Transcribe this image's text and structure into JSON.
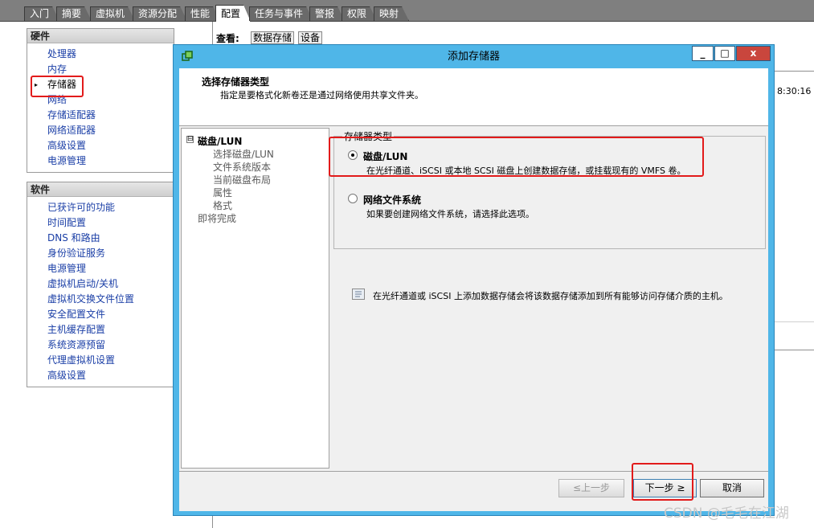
{
  "tabs": [
    {
      "label": "入门",
      "active": false
    },
    {
      "label": "摘要",
      "active": false
    },
    {
      "label": "虚拟机",
      "active": false
    },
    {
      "label": "资源分配",
      "active": false
    },
    {
      "label": "性能",
      "active": false
    },
    {
      "label": "配置",
      "active": true
    },
    {
      "label": "任务与事件",
      "active": false
    },
    {
      "label": "警报",
      "active": false
    },
    {
      "label": "权限",
      "active": false
    },
    {
      "label": "映射",
      "active": false
    }
  ],
  "hardware": {
    "heading": "硬件",
    "items": [
      "处理器",
      "内存",
      "存储器",
      "网络",
      "存储适配器",
      "网络适配器",
      "高级设置",
      "电源管理"
    ],
    "selected": "存储器"
  },
  "software": {
    "heading": "软件",
    "items": [
      "已获许可的功能",
      "时间配置",
      "DNS 和路由",
      "身份验证服务",
      "电源管理",
      "虚拟机启动/关机",
      "虚拟机交换文件位置",
      "安全配置文件",
      "主机缓存配置",
      "系统资源预留",
      "代理虚拟机设置",
      "高级设置"
    ]
  },
  "view": {
    "label": "查看:",
    "options": [
      "数据存储",
      "设备"
    ]
  },
  "background_time": "8:30:16",
  "dialog": {
    "title": "添加存储器",
    "window_buttons": {
      "minimize": "_",
      "maximize": "□",
      "close": "x"
    },
    "header_title": "选择存储器类型",
    "header_subtitle": "指定是要格式化新卷还是通过网络使用共享文件夹。",
    "nav": {
      "root": "磁盘/LUN",
      "toggle": "⊟",
      "children": [
        "选择磁盘/LUN",
        "文件系统版本",
        "当前磁盘布局",
        "属性",
        "格式"
      ],
      "finish": "即将完成"
    },
    "group_label": "存储器类型",
    "options": [
      {
        "title": "磁盘/LUN",
        "desc": "在光纤通道、iSCSI 或本地 SCSI 磁盘上创建数据存储，或挂载现有的 VMFS 卷。",
        "checked": true
      },
      {
        "title": "网络文件系统",
        "desc": "如果要创建网络文件系统，请选择此选项。",
        "checked": false
      }
    ],
    "info_text": "在光纤通道或 iSCSI 上添加数据存储会将该数据存储添加到所有能够访问存储介质的主机。",
    "buttons": {
      "back": "≤上一步",
      "next": "下一步 ≥",
      "cancel": "取消"
    }
  },
  "watermark": "CSDN @毛毛在江湖",
  "colors": {
    "highlight_box": "#e21b1b",
    "dialog_frame": "#4fb6e8",
    "link": "#1a3ea6"
  }
}
